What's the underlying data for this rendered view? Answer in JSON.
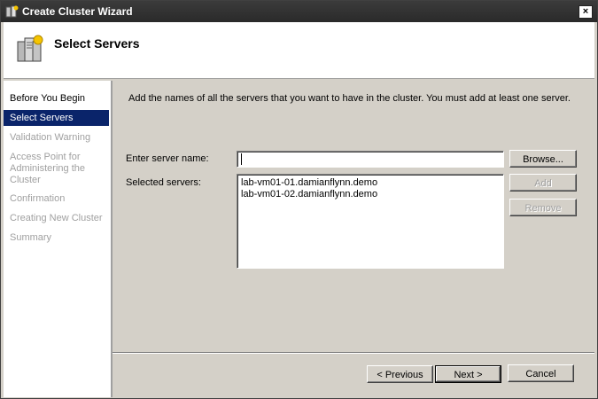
{
  "window": {
    "title": "Create Cluster Wizard",
    "close_label": "×"
  },
  "header": {
    "title": "Select Servers"
  },
  "steps": [
    {
      "label": "Before You Begin",
      "state": "done"
    },
    {
      "label": "Select Servers",
      "state": "current"
    },
    {
      "label": "Validation Warning",
      "state": "pending"
    },
    {
      "label": "Access Point for Administering the Cluster",
      "state": "pending"
    },
    {
      "label": "Confirmation",
      "state": "pending"
    },
    {
      "label": "Creating New Cluster",
      "state": "pending"
    },
    {
      "label": "Summary",
      "state": "pending"
    }
  ],
  "main": {
    "instruction": "Add the names of all the servers that you want to have in the cluster. You must add at least one server.",
    "server_name_label": "Enter server name:",
    "server_name_value": "",
    "selected_label": "Selected servers:",
    "selected_servers": [
      "lab-vm01-01.damianflynn.demo",
      "lab-vm01-02.damianflynn.demo"
    ],
    "browse_label": "Browse...",
    "add_label": "Add",
    "remove_label": "Remove"
  },
  "footer": {
    "previous_label": "< Previous",
    "next_label": "Next >",
    "cancel_label": "Cancel"
  },
  "colors": {
    "selected_step_bg": "#0a246a",
    "titlebar_bg": "#2f2f2f",
    "dialog_bg": "#d4d0c8"
  }
}
